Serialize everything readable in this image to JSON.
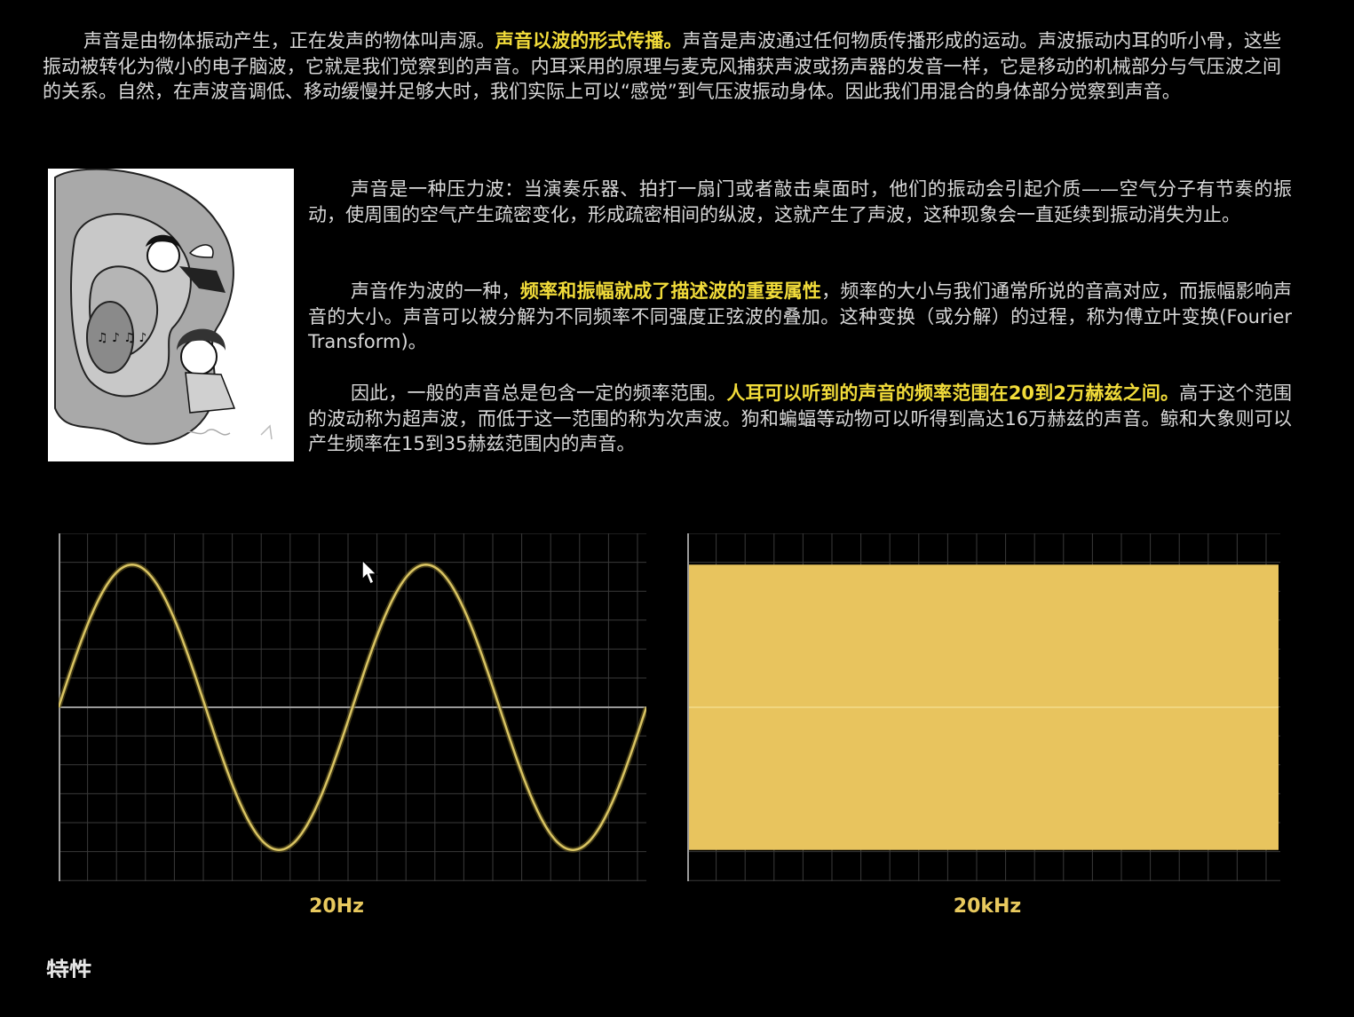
{
  "intro": {
    "before": "声音是由物体振动产生，正在发声的物体叫声源。",
    "highlight": "声音以波的形式传播。",
    "after": "声音是声波通过任何物质传播形成的运动。声波振动内耳的听小骨，这些振动被转化为微小的电子脑波，它就是我们觉察到的声音。内耳采用的原理与麦克风捕获声波或扬声器的发音一样，它是移动的机械部分与气压波之间的关系。自然，在声波音调低、移动缓慢并足够大时，我们实际上可以“感觉”到气压波振动身体。因此我们用混合的身体部分觉察到声音。"
  },
  "p1": {
    "text": "声音是一种压力波：当演奏乐器、拍打一扇门或者敲击桌面时，他们的振动会引起介质——空气分子有节奏的振动，使周围的空气产生疏密变化，形成疏密相间的纵波，这就产生了声波，这种现象会一直延续到振动消失为止。"
  },
  "p2": {
    "before": "声音作为波的一种，",
    "highlight": "频率和振幅就成了描述波的重要属性",
    "after": "，频率的大小与我们通常所说的音高对应，而振幅影响声音的大小。声音可以被分解为不同频率不同强度正弦波的叠加。这种变换（或分解）的过程，称为傅立叶变换(Fourier Transform)。"
  },
  "p3": {
    "before": "因此，一般的声音总是包含一定的频率范围。",
    "highlight": "人耳可以听到的声音的频率范围在20到2万赫兹之间。",
    "after": "高于这个范围的波动称为超声波，而低于这一范围的称为次声波。狗和蝙蝠等动物可以听得到高达16万赫兹的声音。鲸和大象则可以产生频率在15到35赫兹范围内的声音。"
  },
  "illustration": {
    "icon": "cartoon-ear-illustration"
  },
  "chart_data": [
    {
      "type": "line",
      "title": "20Hz",
      "cycles": 2,
      "amplitude": 0.82,
      "grid": true,
      "line_color": "#d9c463"
    },
    {
      "type": "area",
      "title": "20kHz",
      "amplitude": 0.82,
      "grid": true,
      "fill_color": "#e8c45e"
    }
  ],
  "bottom": {
    "heading": "特性"
  },
  "colors": {
    "background": "#000000",
    "text": "#d9d9d9",
    "highlight": "#f2dc3a",
    "chart_label": "#e8c95e",
    "grid": "#3a3a3a"
  }
}
